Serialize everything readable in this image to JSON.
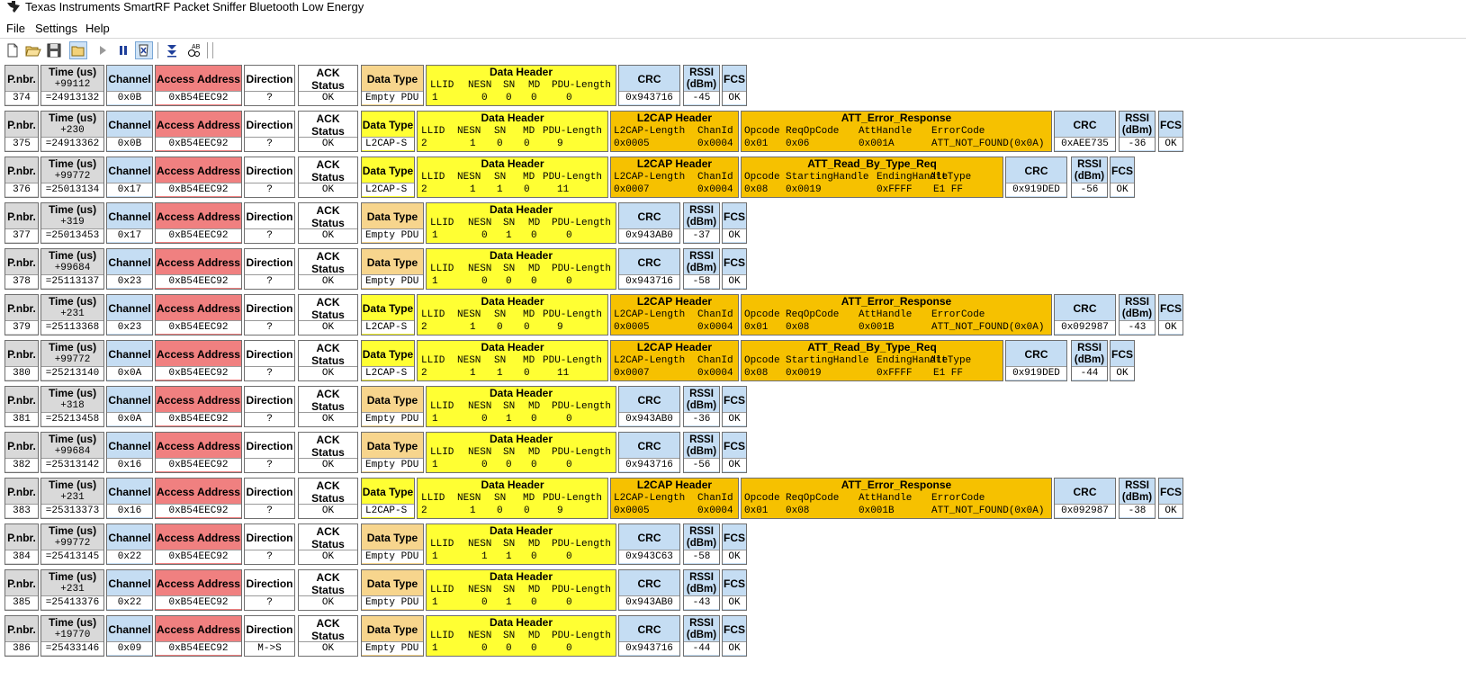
{
  "window": {
    "title": "Texas Instruments SmartRF Packet Sniffer Bluetooth Low Energy"
  },
  "menu": [
    "File",
    "Settings",
    "Help"
  ],
  "toolbar": [
    {
      "name": "new-icon",
      "pressed": false
    },
    {
      "name": "open-icon",
      "pressed": false
    },
    {
      "name": "save-icon",
      "pressed": false
    },
    {
      "name": "open-folder-icon",
      "pressed": true
    },
    {
      "name": "play-icon",
      "pressed": false
    },
    {
      "name": "pause-icon",
      "pressed": false
    },
    {
      "name": "clear-icon",
      "pressed": true
    },
    {
      "name": "autoscroll-icon",
      "pressed": false
    },
    {
      "name": "display-format-icon",
      "pressed": false
    }
  ],
  "headers": {
    "pnbr": "P.nbr.",
    "time": "Time (us)",
    "channel": "Channel",
    "access_address": "Access Address",
    "direction": "Direction",
    "ack_status": "ACK Status",
    "data_type": "Data Type",
    "data_header": "Data Header",
    "data_header_fields": [
      "LLID",
      "NESN",
      "SN",
      "MD",
      "PDU-Length"
    ],
    "l2cap_header": "L2CAP Header",
    "l2cap_fields": [
      "L2CAP-Length",
      "ChanId"
    ],
    "att_error_fields": [
      "Opcode",
      "ReqOpCode",
      "AttHandle",
      "ErrorCode"
    ],
    "att_read_fields": [
      "Opcode",
      "StartingHandle",
      "EndingHandle",
      "AttType"
    ],
    "crc": "CRC",
    "rssi": [
      "RSSI",
      "(dBm)"
    ],
    "fcs": "FCS"
  },
  "packets": [
    {
      "nbr": "374",
      "delta": "+99112",
      "time": "=24913132",
      "channel": "0x0B",
      "aa": "0xB54EEC92",
      "dir": "?",
      "ack": "OK",
      "dtype": "Empty PDU",
      "dh": [
        "1",
        "0",
        "0",
        "0",
        "0"
      ],
      "crc": "0x943716",
      "rssi": "-45",
      "fcs": "OK"
    },
    {
      "nbr": "375",
      "delta": "+230",
      "time": "=24913362",
      "channel": "0x0B",
      "aa": "0xB54EEC92",
      "dir": "?",
      "ack": "OK",
      "dtype": "L2CAP-S",
      "dh": [
        "2",
        "1",
        "0",
        "0",
        "9"
      ],
      "l2cap": [
        "0x0005",
        "0x0004"
      ],
      "att": {
        "kind": "error",
        "title": "ATT_Error_Response",
        "values": [
          "0x01",
          "0x06",
          "0x001A",
          "ATT_NOT_FOUND(0x0A)"
        ]
      },
      "crc": "0xAEE735",
      "rssi": "-36",
      "fcs": "OK"
    },
    {
      "nbr": "376",
      "delta": "+99772",
      "time": "=25013134",
      "channel": "0x17",
      "aa": "0xB54EEC92",
      "dir": "?",
      "ack": "OK",
      "dtype": "L2CAP-S",
      "dh": [
        "2",
        "1",
        "1",
        "0",
        "11"
      ],
      "l2cap": [
        "0x0007",
        "0x0004"
      ],
      "att": {
        "kind": "read",
        "title": "ATT_Read_By_Type_Req",
        "values": [
          "0x08",
          "0x0019",
          "0xFFFF",
          "E1 FF"
        ]
      },
      "crc": "0x919DED",
      "rssi": "-56",
      "fcs": "OK"
    },
    {
      "nbr": "377",
      "delta": "+319",
      "time": "=25013453",
      "channel": "0x17",
      "aa": "0xB54EEC92",
      "dir": "?",
      "ack": "OK",
      "dtype": "Empty PDU",
      "dh": [
        "1",
        "0",
        "1",
        "0",
        "0"
      ],
      "crc": "0x943AB0",
      "rssi": "-37",
      "fcs": "OK"
    },
    {
      "nbr": "378",
      "delta": "+99684",
      "time": "=25113137",
      "channel": "0x23",
      "aa": "0xB54EEC92",
      "dir": "?",
      "ack": "OK",
      "dtype": "Empty PDU",
      "dh": [
        "1",
        "0",
        "0",
        "0",
        "0"
      ],
      "crc": "0x943716",
      "rssi": "-58",
      "fcs": "OK"
    },
    {
      "nbr": "379",
      "delta": "+231",
      "time": "=25113368",
      "channel": "0x23",
      "aa": "0xB54EEC92",
      "dir": "?",
      "ack": "OK",
      "dtype": "L2CAP-S",
      "dh": [
        "2",
        "1",
        "0",
        "0",
        "9"
      ],
      "l2cap": [
        "0x0005",
        "0x0004"
      ],
      "att": {
        "kind": "error",
        "title": "ATT_Error_Response",
        "values": [
          "0x01",
          "0x08",
          "0x001B",
          "ATT_NOT_FOUND(0x0A)"
        ]
      },
      "crc": "0x092987",
      "rssi": "-43",
      "fcs": "OK"
    },
    {
      "nbr": "380",
      "delta": "+99772",
      "time": "=25213140",
      "channel": "0x0A",
      "aa": "0xB54EEC92",
      "dir": "?",
      "ack": "OK",
      "dtype": "L2CAP-S",
      "dh": [
        "2",
        "1",
        "1",
        "0",
        "11"
      ],
      "l2cap": [
        "0x0007",
        "0x0004"
      ],
      "att": {
        "kind": "read",
        "title": "ATT_Read_By_Type_Req",
        "values": [
          "0x08",
          "0x0019",
          "0xFFFF",
          "E1 FF"
        ]
      },
      "crc": "0x919DED",
      "rssi": "-44",
      "fcs": "OK"
    },
    {
      "nbr": "381",
      "delta": "+318",
      "time": "=25213458",
      "channel": "0x0A",
      "aa": "0xB54EEC92",
      "dir": "?",
      "ack": "OK",
      "dtype": "Empty PDU",
      "dh": [
        "1",
        "0",
        "1",
        "0",
        "0"
      ],
      "crc": "0x943AB0",
      "rssi": "-36",
      "fcs": "OK"
    },
    {
      "nbr": "382",
      "delta": "+99684",
      "time": "=25313142",
      "channel": "0x16",
      "aa": "0xB54EEC92",
      "dir": "?",
      "ack": "OK",
      "dtype": "Empty PDU",
      "dh": [
        "1",
        "0",
        "0",
        "0",
        "0"
      ],
      "crc": "0x943716",
      "rssi": "-56",
      "fcs": "OK"
    },
    {
      "nbr": "383",
      "delta": "+231",
      "time": "=25313373",
      "channel": "0x16",
      "aa": "0xB54EEC92",
      "dir": "?",
      "ack": "OK",
      "dtype": "L2CAP-S",
      "dh": [
        "2",
        "1",
        "0",
        "0",
        "9"
      ],
      "l2cap": [
        "0x0005",
        "0x0004"
      ],
      "att": {
        "kind": "error",
        "title": "ATT_Error_Response",
        "values": [
          "0x01",
          "0x08",
          "0x001B",
          "ATT_NOT_FOUND(0x0A)"
        ]
      },
      "crc": "0x092987",
      "rssi": "-38",
      "fcs": "OK"
    },
    {
      "nbr": "384",
      "delta": "+99772",
      "time": "=25413145",
      "channel": "0x22",
      "aa": "0xB54EEC92",
      "dir": "?",
      "ack": "OK",
      "dtype": "Empty PDU",
      "dh": [
        "1",
        "1",
        "1",
        "0",
        "0"
      ],
      "crc": "0x943C63",
      "rssi": "-58",
      "fcs": "OK"
    },
    {
      "nbr": "385",
      "delta": "+231",
      "time": "=25413376",
      "channel": "0x22",
      "aa": "0xB54EEC92",
      "dir": "?",
      "ack": "OK",
      "dtype": "Empty PDU",
      "dh": [
        "1",
        "0",
        "1",
        "0",
        "0"
      ],
      "crc": "0x943AB0",
      "rssi": "-43",
      "fcs": "OK"
    },
    {
      "nbr": "386",
      "delta": "+19770",
      "time": "=25433146",
      "channel": "0x09",
      "aa": "0xB54EEC92",
      "dir": "M->S",
      "ack": "OK",
      "dtype": "Empty PDU",
      "dh": [
        "1",
        "0",
        "0",
        "0",
        "0"
      ],
      "crc": "0x943716",
      "rssi": "-44",
      "fcs": "OK"
    }
  ]
}
